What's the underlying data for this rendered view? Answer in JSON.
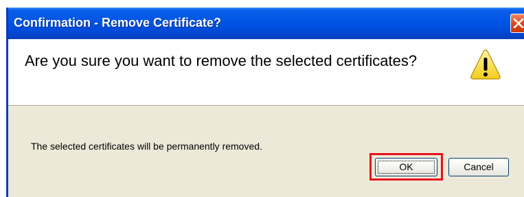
{
  "dialog": {
    "title": "Confirmation - Remove Certificate?",
    "heading": "Are you sure you want to remove the selected certificates?",
    "description": "The selected certificates will be permanently removed.",
    "icon": "warning-icon",
    "buttons": {
      "ok_label": "OK",
      "cancel_label": "Cancel"
    },
    "close_icon": "close-icon",
    "highlight_color": "#e8101a",
    "titlebar_color": "#0055e5"
  }
}
